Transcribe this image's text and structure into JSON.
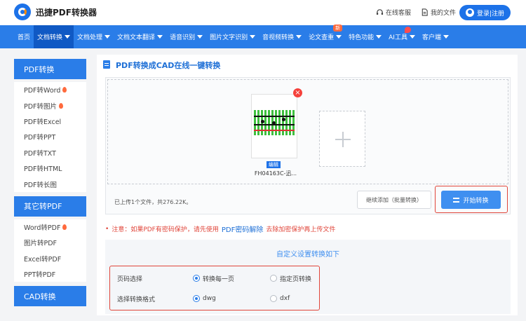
{
  "header": {
    "brand": "迅捷PDF转换器",
    "online_service": "在线客服",
    "my_files": "我的文件",
    "login": "登录|注册"
  },
  "nav": {
    "items": [
      {
        "label": "首页",
        "dropdown": false
      },
      {
        "label": "文档转换",
        "dropdown": true,
        "active": true
      },
      {
        "label": "文档处理",
        "dropdown": true
      },
      {
        "label": "文档文本翻译",
        "dropdown": true
      },
      {
        "label": "语音识别",
        "dropdown": true
      },
      {
        "label": "图片文字识别",
        "dropdown": true
      },
      {
        "label": "音视频转换",
        "dropdown": true
      },
      {
        "label": "论文查重",
        "dropdown": true,
        "badge": "新"
      },
      {
        "label": "特色功能",
        "dropdown": true
      },
      {
        "label": "AI工具",
        "dropdown": true
      },
      {
        "label": "客户端",
        "dropdown": true
      }
    ]
  },
  "sidebar": {
    "groups": [
      {
        "title": "PDF转换",
        "items": [
          {
            "label": "PDF转Word",
            "hot": true
          },
          {
            "label": "PDF转图片",
            "hot": true
          },
          {
            "label": "PDF转Excel"
          },
          {
            "label": "PDF转PPT"
          },
          {
            "label": "PDF转TXT"
          },
          {
            "label": "PDF转HTML"
          },
          {
            "label": "PDF转长图"
          }
        ]
      },
      {
        "title": "其它转PDF",
        "items": [
          {
            "label": "Word转PDF",
            "hot": true
          },
          {
            "label": "图片转PDF"
          },
          {
            "label": "Excel转PDF"
          },
          {
            "label": "PPT转PDF"
          }
        ]
      },
      {
        "title": "CAD转换",
        "items": []
      }
    ]
  },
  "main": {
    "title": "PDF转换成CAD在线一键转换",
    "file": {
      "name": "FH04163C-迅...",
      "edit_label": "编辑",
      "delete_label": "×"
    },
    "upload_info": "已上传1个文件，共276.22K。",
    "continue_label": "继续添加（批量转换）",
    "start_label": "开始转换",
    "notice": {
      "prefix": "注意：如果PDF有密码保护，请先使用",
      "link": "PDF密码解除",
      "suffix": "去除加密保护再上传文件"
    },
    "settings": {
      "title": "自定义设置转换如下",
      "rows": [
        {
          "label": "页码选择",
          "options": [
            {
              "label": "转换每一页",
              "selected": true
            },
            {
              "label": "指定页转换",
              "selected": false
            }
          ]
        },
        {
          "label": "选择转换格式",
          "options": [
            {
              "label": "dwg",
              "selected": true
            },
            {
              "label": "dxf",
              "selected": false
            }
          ]
        }
      ]
    }
  },
  "colors": {
    "primary": "#2a7de8",
    "highlight": "#e0453a",
    "link": "#1d6fd6"
  }
}
